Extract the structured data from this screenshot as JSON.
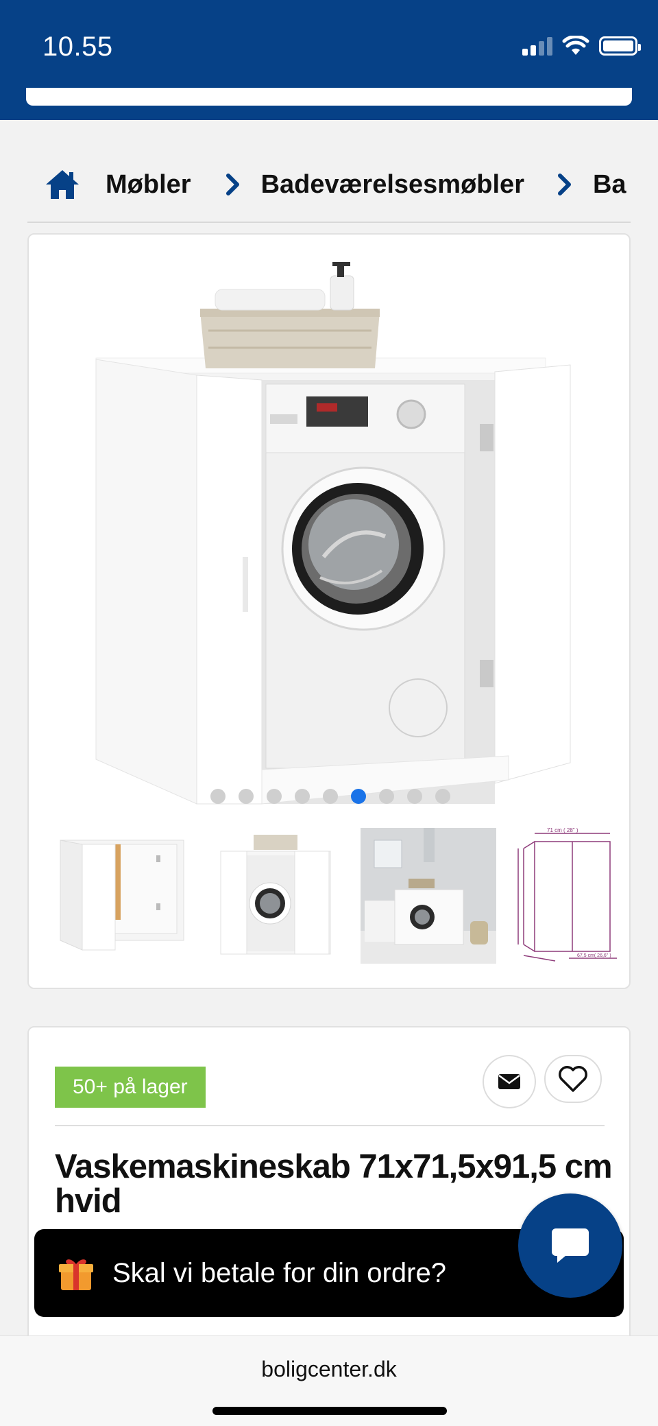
{
  "status_bar": {
    "time": "10.55"
  },
  "breadcrumb": {
    "items": [
      "Møbler",
      "Badeværelsesmøbler",
      "Ba"
    ]
  },
  "gallery": {
    "image_count": 9,
    "active_index": 5,
    "thumbnails": [
      "cabinet-open-empty",
      "cabinet-with-washer",
      "cabinet-in-bathroom",
      "cabinet-dimensions-drawing"
    ],
    "dimension_labels": [
      "71 cm ( 28\" )",
      "67,5 cm( 26,6\" )"
    ]
  },
  "product": {
    "stock": "50+ på lager",
    "title": "Vaskemaskineskab 71x71,5x91,5 cm hvid"
  },
  "toast": {
    "text": "Skal vi betale for din ordre?"
  },
  "browser": {
    "url": "boligcenter.dk"
  },
  "colors": {
    "brand": "#064187",
    "stock": "#7ec44a",
    "active_dot": "#1a73e8"
  }
}
